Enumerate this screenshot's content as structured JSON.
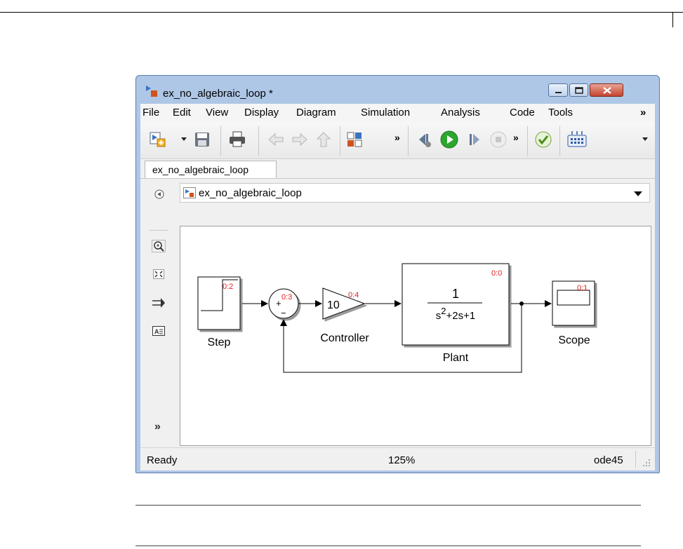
{
  "window": {
    "title": "ex_no_algebraic_loop *",
    "controls": [
      "minimize-icon",
      "maximize-icon",
      "close-icon"
    ]
  },
  "menu": {
    "items": [
      "File",
      "Edit",
      "View",
      "Display",
      "Diagram",
      "Simulation",
      "Analysis",
      "Code",
      "Tools"
    ],
    "overflow": "»"
  },
  "toolbar": {
    "icons": [
      "new-model-icon",
      "save-icon",
      "print-icon",
      "back-arrow-icon",
      "forward-arrow-icon",
      "up-arrow-icon",
      "library-browser-icon",
      "step-back-icon",
      "run-icon",
      "step-forward-icon",
      "stop-icon",
      "model-advisor-icon",
      "build-icon"
    ],
    "overflow_1": "»",
    "overflow_2": "»"
  },
  "tab": {
    "label": "ex_no_algebraic_loop"
  },
  "address": {
    "path": "ex_no_algebraic_loop"
  },
  "palette": {
    "icons": [
      "hide-explorer-icon",
      "zoom-icon",
      "fit-to-view-icon",
      "signal-arrow-icon",
      "annotation-icon",
      "expand-palette-icon"
    ],
    "expand": "»"
  },
  "diagram": {
    "step": {
      "label": "Step",
      "sample_time": "0:2"
    },
    "sum": {
      "sample_time": "0:3",
      "signs": [
        "+",
        "−"
      ]
    },
    "controller": {
      "label": "Controller",
      "gain": "10",
      "sample_time": "0:4"
    },
    "plant": {
      "label": "Plant",
      "numerator": "1",
      "denominator": "s2+2s+1",
      "den_s": "s",
      "den_exp": "2",
      "den_rest": "+2s+1",
      "sample_time": "0:0"
    },
    "scope": {
      "label": "Scope",
      "sample_time": "0:1"
    }
  },
  "status": {
    "state": "Ready",
    "zoom": "125%",
    "solver": "ode45"
  },
  "colors": {
    "window_frame": "#aec7e6",
    "run_green": "#2ea52e",
    "sample_time_red": "#e02020",
    "close_red": "#c5432f"
  }
}
